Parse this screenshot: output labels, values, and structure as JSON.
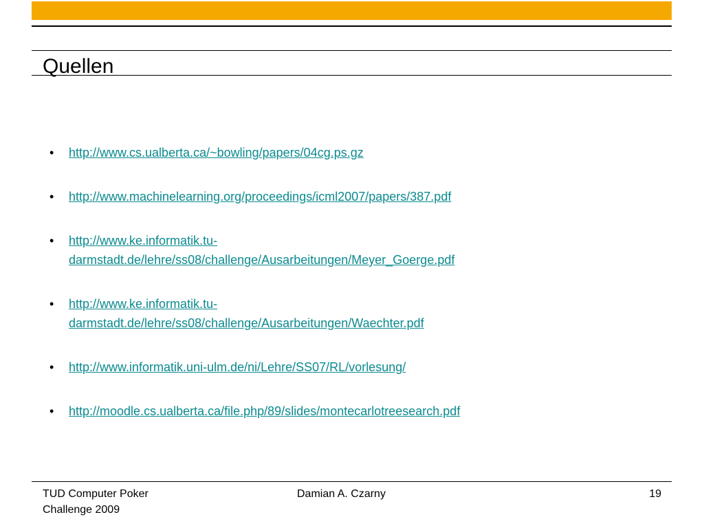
{
  "colors": {
    "accent_bar": "#f5a800",
    "link": "#0b8a8f",
    "rules": "#000000"
  },
  "slide": {
    "title": "Quellen"
  },
  "sources": [
    {
      "bullet": "•",
      "url": "http://www.cs.ualberta.ca/~bowling/papers/04cg.ps.gz"
    },
    {
      "bullet": "•",
      "url": "http://www.machinelearning.org/proceedings/icml2007/papers/387.pdf"
    },
    {
      "bullet": "•",
      "url": "http://www.ke.informatik.tu-\ndarmstadt.de/lehre/ss08/challenge/Ausarbeitungen/Meyer_Goerge.pdf"
    },
    {
      "bullet": "•",
      "url": "http://www.ke.informatik.tu-\ndarmstadt.de/lehre/ss08/challenge/Ausarbeitungen/Waechter.pdf"
    },
    {
      "bullet": "•",
      "url": "http://www.informatik.uni-ulm.de/ni/Lehre/SS07/RL/vorlesung/"
    },
    {
      "bullet": "•",
      "url": "http://moodle.cs.ualberta.ca/file.php/89/slides/montecarlotreesearch.pdf"
    }
  ],
  "footer": {
    "left": "TUD Computer Poker\nChallenge 2009",
    "center": "Damian A. Czarny",
    "page_number": "19"
  }
}
